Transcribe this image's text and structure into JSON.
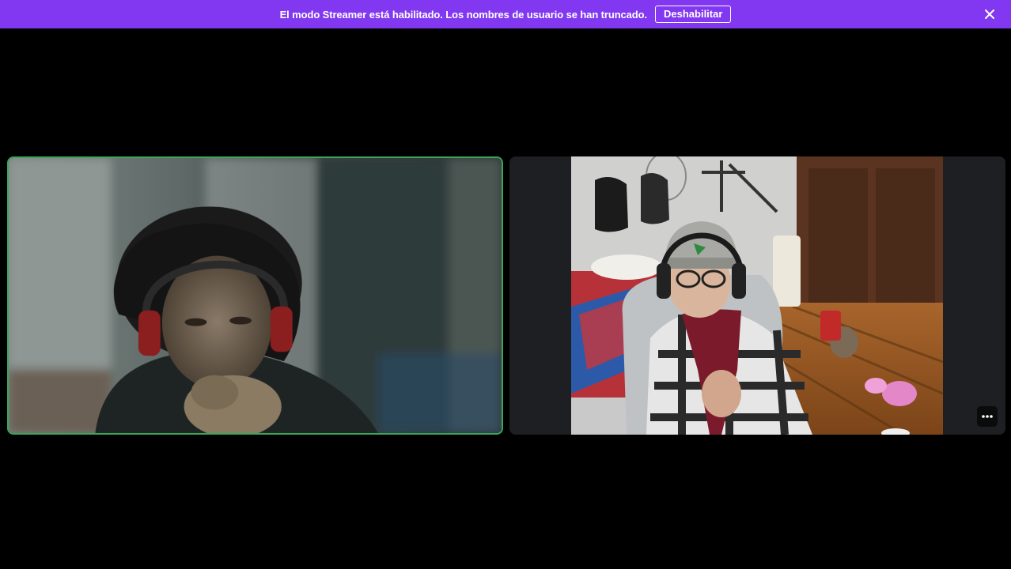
{
  "notice": {
    "message": "El modo Streamer está habilitado. Los nombres de usuario se han truncado.",
    "disable_label": "Deshabilitar",
    "background_color": "#8138f0",
    "close_icon": "close-icon"
  },
  "call": {
    "active_speaker_border_color": "#3ba55c",
    "tiles": [
      {
        "position": "left",
        "speaking": true
      },
      {
        "position": "right",
        "speaking": false,
        "more_options_icon": "more-options-icon"
      }
    ]
  }
}
